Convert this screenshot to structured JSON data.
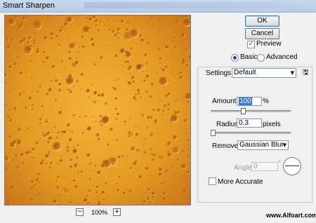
{
  "window": {
    "title": "Smart Sharpen"
  },
  "preview": {
    "zoom_out": "−",
    "zoom_in": "+",
    "zoom_level": "100%"
  },
  "buttons": {
    "ok": "OK",
    "cancel": "Cancel"
  },
  "preview_checkbox": {
    "label": "Preview",
    "checked": true
  },
  "mode": {
    "basic": "Basic",
    "advanced": "Advanced",
    "selected": "Basic"
  },
  "settings": {
    "label": "Settings:",
    "value": "Default"
  },
  "amount": {
    "label": "Amount:",
    "value": "100",
    "unit": "%",
    "level": 0.4
  },
  "radius": {
    "label": "Radius:",
    "value": "0.3",
    "unit": "pixels",
    "level": 0.01
  },
  "remove": {
    "label": "Remove:",
    "value": "Gaussian Blur"
  },
  "angle": {
    "label": "Angle:",
    "value": "0",
    "unit": "°"
  },
  "more_accurate": {
    "label": "More Accurate",
    "checked": false
  },
  "watermark": "www.Alfoart.com",
  "colors": {
    "texture_base": "#d6881a",
    "accent": "#3875d7"
  },
  "icons": {
    "save_settings": "save-settings-icon",
    "dial": "angle-dial-icon"
  }
}
